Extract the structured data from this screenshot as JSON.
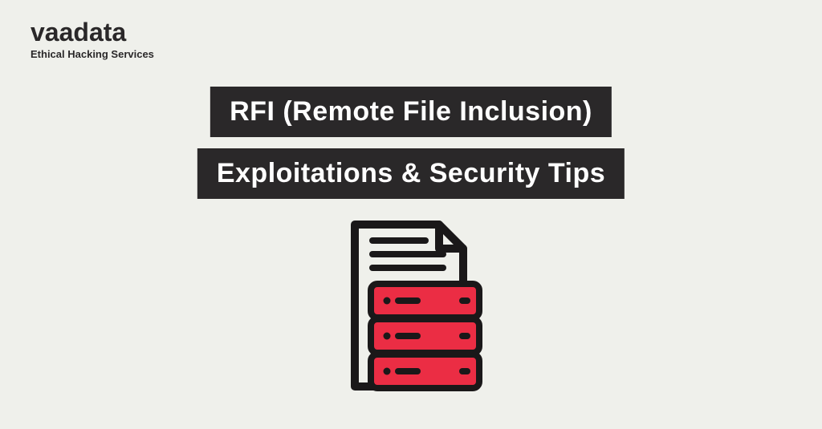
{
  "logo": {
    "brand": "vaadata",
    "tagline": "Ethical Hacking Services"
  },
  "titles": {
    "line1": "RFI (Remote File Inclusion)",
    "line2": "Exploitations & Security Tips"
  },
  "colors": {
    "background": "#eff0eb",
    "banner": "#2a2829",
    "bannerText": "#ffffff",
    "accent": "#eb2d44"
  },
  "illustration": {
    "name": "document-server-icon"
  }
}
